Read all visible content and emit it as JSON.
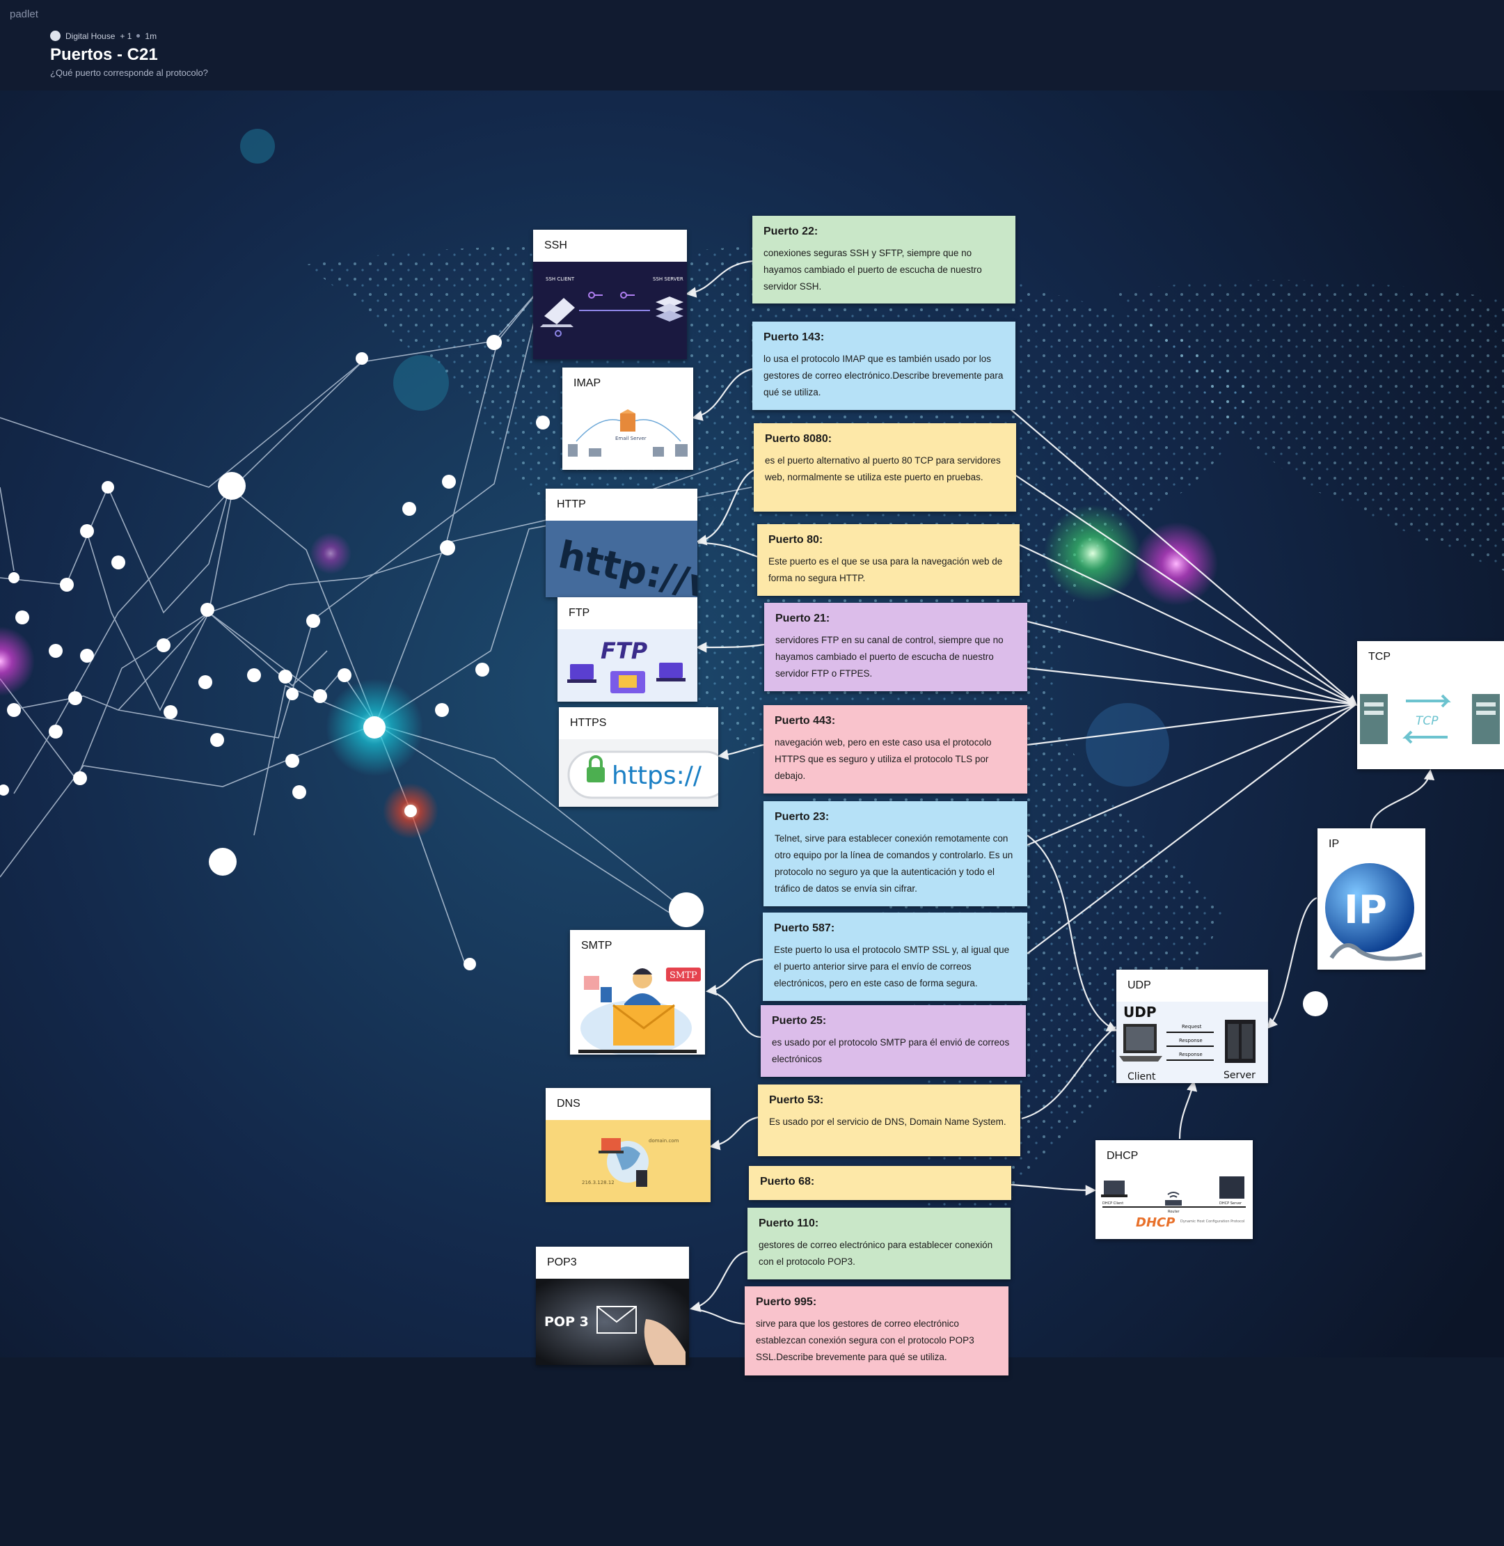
{
  "brand": "padlet",
  "header": {
    "author": "Digital House",
    "plus_count": "+ 1",
    "time": "1m",
    "title": "Puertos - C21",
    "subtitle": "¿Qué puerto corresponde al protocolo?"
  },
  "protocols": {
    "ssh": {
      "label": "SSH",
      "client": "SSH CLIENT",
      "server": "SSH SERVER"
    },
    "imap": {
      "label": "IMAP",
      "server": "Email Server"
    },
    "http": {
      "label": "HTTP",
      "image_text": "http://ww"
    },
    "ftp": {
      "label": "FTP",
      "image_text": "FTP"
    },
    "https": {
      "label": "HTTPS",
      "image_text": "https://"
    },
    "smtp": {
      "label": "SMTP",
      "image_text": "SMTP"
    },
    "dns": {
      "label": "DNS",
      "image_text": "domain.com",
      "ip_text": "216.3.128.12"
    },
    "pop3": {
      "label": "POP3",
      "image_text": "POP 3"
    },
    "tcp": {
      "label": "TCP",
      "image_text": "TCP"
    },
    "ip": {
      "label": "IP",
      "image_text": "IP"
    },
    "udp": {
      "label": "UDP",
      "image_text": "UDP",
      "request": "Request",
      "response1": "Response",
      "response2": "Response",
      "client": "Client",
      "server": "Server"
    },
    "dhcp": {
      "label": "DHCP",
      "image_text": "DHCP",
      "client": "DHCP Client",
      "server": "DHCP Server",
      "router": "Router",
      "caption": "Dynamic Host Configuration Protocol"
    }
  },
  "notes": {
    "p22": {
      "title": "Puerto 22:",
      "text": "conexiones seguras SSH y SFTP, siempre que no hayamos cambiado el puerto de escucha de nuestro servidor SSH."
    },
    "p143": {
      "title": "Puerto 143:",
      "text": "lo usa el protocolo IMAP que es también usado por los gestores de correo electrónico.Describe brevemente para qué se utiliza."
    },
    "p8080": {
      "title": "Puerto 8080:",
      "text": "es el puerto alternativo al puerto 80 TCP para servidores web, normalmente se utiliza este puerto en pruebas."
    },
    "p80": {
      "title": "Puerto 80:",
      "text": "Este puerto es el que se usa para la navegación web de forma no segura HTTP."
    },
    "p21": {
      "title": "Puerto 21:",
      "text": "servidores FTP en su canal de control, siempre que no hayamos cambiado el puerto de escucha de nuestro servidor FTP o FTPES."
    },
    "p443": {
      "title": "Puerto 443:",
      "text": "navegación web, pero en este caso usa el protocolo HTTPS que es seguro y utiliza el protocolo TLS por debajo."
    },
    "p23": {
      "title": "Puerto 23:",
      "text": "Telnet, sirve para establecer conexión remotamente con otro equipo por la línea de comandos y controlarlo. Es un protocolo no seguro ya que la autenticación y todo el tráfico de datos se envía sin cifrar."
    },
    "p587": {
      "title": "Puerto 587:",
      "text": "Este puerto lo usa el protocolo SMTP SSL y, al igual que el puerto anterior sirve para el envío de correos electrónicos, pero en este caso de forma segura."
    },
    "p25": {
      "title": "Puerto 25:",
      "text": "es usado por el protocolo SMTP para él envió de correos electrónicos"
    },
    "p53": {
      "title": "Puerto 53:",
      "text": "Es usado por el servicio de DNS, Domain Name System."
    },
    "p68": {
      "title": "Puerto 68:",
      "text": ""
    },
    "p110": {
      "title": "Puerto 110:",
      "text": "gestores de correo electrónico para establecer conexión con el protocolo POP3."
    },
    "p995": {
      "title": "Puerto 995:",
      "text": "sirve para que los gestores de correo electrónico establezcan conexión segura con el protocolo POP3 SSL.Describe brevemente para qué se utiliza."
    }
  },
  "colors": {
    "background": "#101a30",
    "green": "#c9e7c8",
    "blue": "#b6e1f7",
    "yellow": "#fde8a8",
    "pink": "#f9c3cc",
    "purple": "#dcbdea",
    "connector": "#ffffff"
  }
}
